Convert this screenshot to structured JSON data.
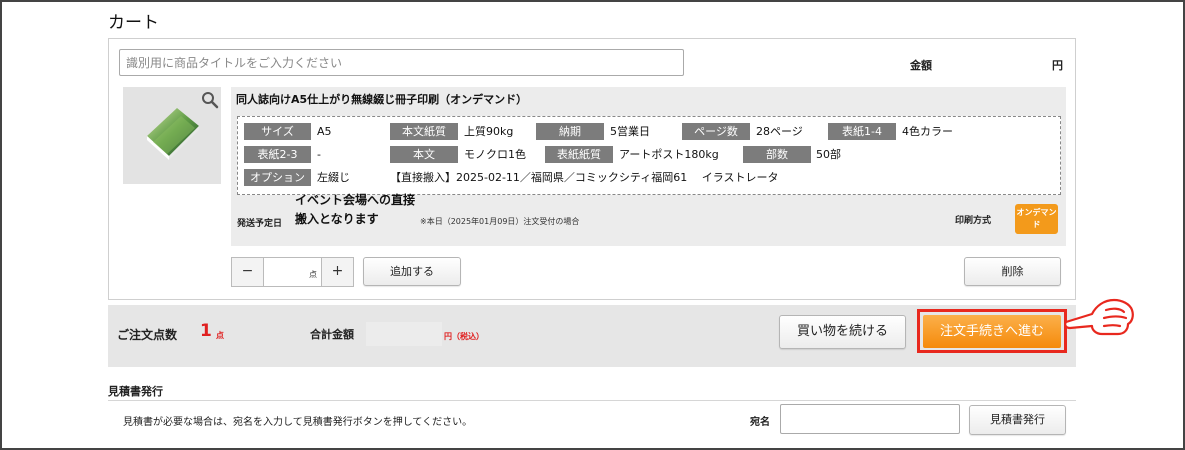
{
  "page": {
    "title": "カート"
  },
  "item": {
    "title_input": {
      "placeholder": "識別用に商品タイトルをご入力ください",
      "value": ""
    },
    "amount_label": "金額",
    "amount_unit": "円",
    "name": "同人誌向けA5仕上がり無線綴じ冊子印刷（オンデマンド）",
    "specs": {
      "size_label": "サイズ",
      "size_value": "A5",
      "body_paper_label": "本文紙質",
      "body_paper_value": "上質90kg",
      "delivery_label": "納期",
      "delivery_value": "5営業日",
      "pages_label": "ページ数",
      "pages_value": "28ページ",
      "cover14_label": "表紙1-4",
      "cover14_value": "4色カラー",
      "cover23_label": "表紙2-3",
      "cover23_value": "-",
      "body_label": "本文",
      "body_value": "モノクロ1色",
      "cover_paper_label": "表紙紙質",
      "cover_paper_value": "アートポスト180kg",
      "copies_label": "部数",
      "copies_value": "50部",
      "option_label": "オプション",
      "option_value": "左綴じ",
      "option_extra": "【直接搬入】2025-02-11／福岡県／コミックシティ福岡61　 イラストレータ"
    },
    "ship_label": "発送予定日",
    "ship_value": "イベント会場への直接搬入となります",
    "ship_note": "※本日（2025年01月09日）注文受付の場合",
    "print_label": "印刷方式",
    "print_badge": "オンデマンド",
    "qty_minus": "−",
    "qty_plus": "+",
    "qty_value": "",
    "qty_unit": "点",
    "add_button": "追加する",
    "delete_button": "削除"
  },
  "summary": {
    "count_label": "ご注文点数",
    "count_value": "1",
    "count_unit": "点",
    "total_label": "合計金額",
    "total_value": "",
    "total_unit": "円（税込）",
    "continue_button": "買い物を続ける",
    "checkout_button": "注文手続きへ進む",
    "accent_color": "#f58a0b",
    "highlight_color": "#e8281e"
  },
  "quote": {
    "title": "見積書発行",
    "description": "見積書が必要な場合は、宛名を入力して見積書発行ボタンを押してください。",
    "addressee_label": "宛名",
    "addressee_value": "",
    "button": "見積書発行"
  },
  "icons": [
    "search-icon",
    "book-thumbnail",
    "pointing-hand-icon"
  ]
}
